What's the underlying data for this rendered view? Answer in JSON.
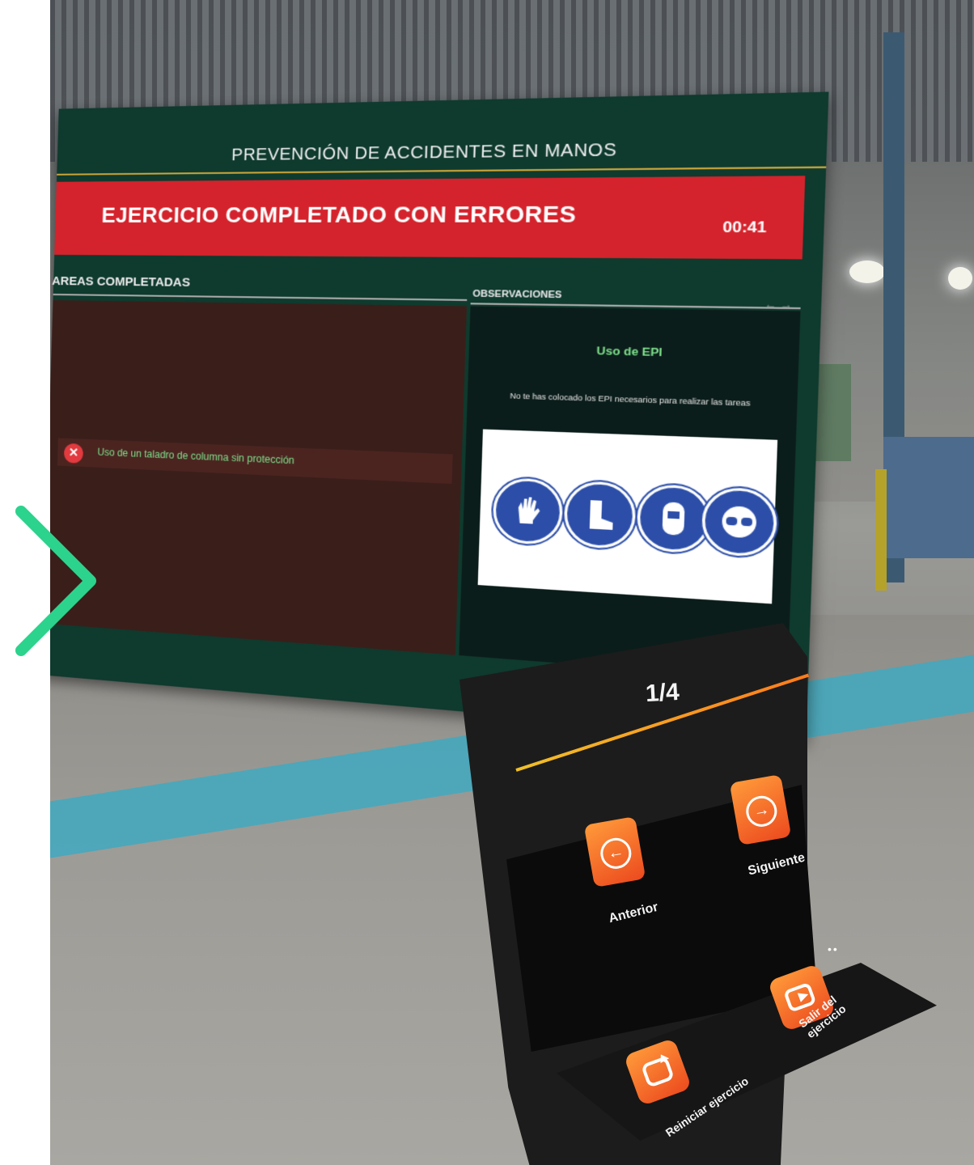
{
  "nav": {
    "next_arrow_color": "#2bd38c"
  },
  "board": {
    "header_title": "PREVENCIÓN DE ACCIDENTES EN MANOS",
    "status_banner": "EJERCICIO COMPLETADO CON ERRORES",
    "timer": "00:41",
    "banner_color": "#d4232c",
    "tasks_heading": "AREAS COMPLETADAS",
    "tasks": [
      {
        "label": "Uso de un taladro de columna sin protección",
        "status_icon": "error-x-icon"
      }
    ],
    "observations": {
      "heading": "OBSERVACIONES",
      "arrows": "← →",
      "title": "Uso de EPI",
      "description": "No te has colocado los EPI necesarios para realizar las tareas",
      "epi_icons": [
        "gloves-icon",
        "safety-boots-icon",
        "face-shield-icon",
        "safety-goggles-icon"
      ]
    }
  },
  "kiosk": {
    "page_indicator": "1/4",
    "prev_label": "Anterior",
    "next_label": "Siguiente",
    "more_indicator": "••",
    "restart_label": "Reiniciar ejercicio",
    "exit_label": "Salir del ejercicio",
    "accent_gradient": [
      "#ff9a3a",
      "#ec4a1e"
    ]
  }
}
